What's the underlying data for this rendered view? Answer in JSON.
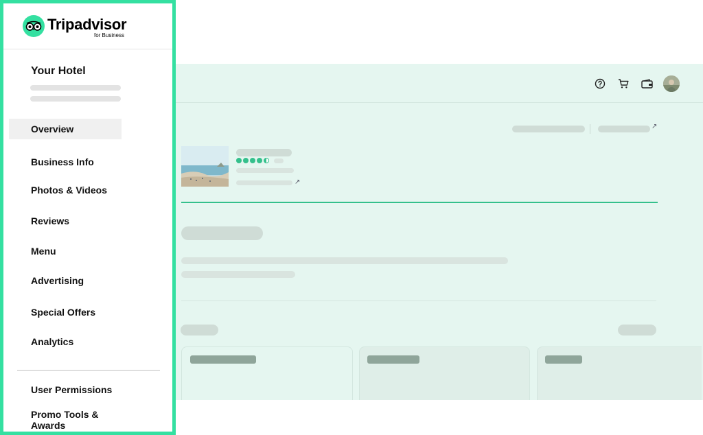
{
  "brand": {
    "name": "Tripadvisor",
    "sub": "for Business",
    "color": "#34e0a1"
  },
  "sidebar": {
    "hotel_name": "Your Hotel",
    "items": [
      {
        "label": "Overview",
        "active": true
      },
      {
        "label": "Business Info"
      },
      {
        "label": "Photos & Videos"
      },
      {
        "label": "Reviews"
      },
      {
        "label": "Menu"
      },
      {
        "label": "Advertising"
      },
      {
        "label": "Special Offers"
      },
      {
        "label": "Analytics"
      }
    ],
    "secondary_items": [
      {
        "label": "User Permissions"
      },
      {
        "label": "Promo Tools & Awards"
      }
    ]
  },
  "header": {
    "icons": [
      "help-icon",
      "cart-icon",
      "wallet-icon",
      "avatar"
    ]
  },
  "listing": {
    "rating_bubbles": 4.5,
    "rating_max": 5
  },
  "colors": {
    "accent": "#34e0a1",
    "rating": "#34c08c",
    "mint_background": "#e5f6f0",
    "skeleton": "#cfdcd6"
  }
}
